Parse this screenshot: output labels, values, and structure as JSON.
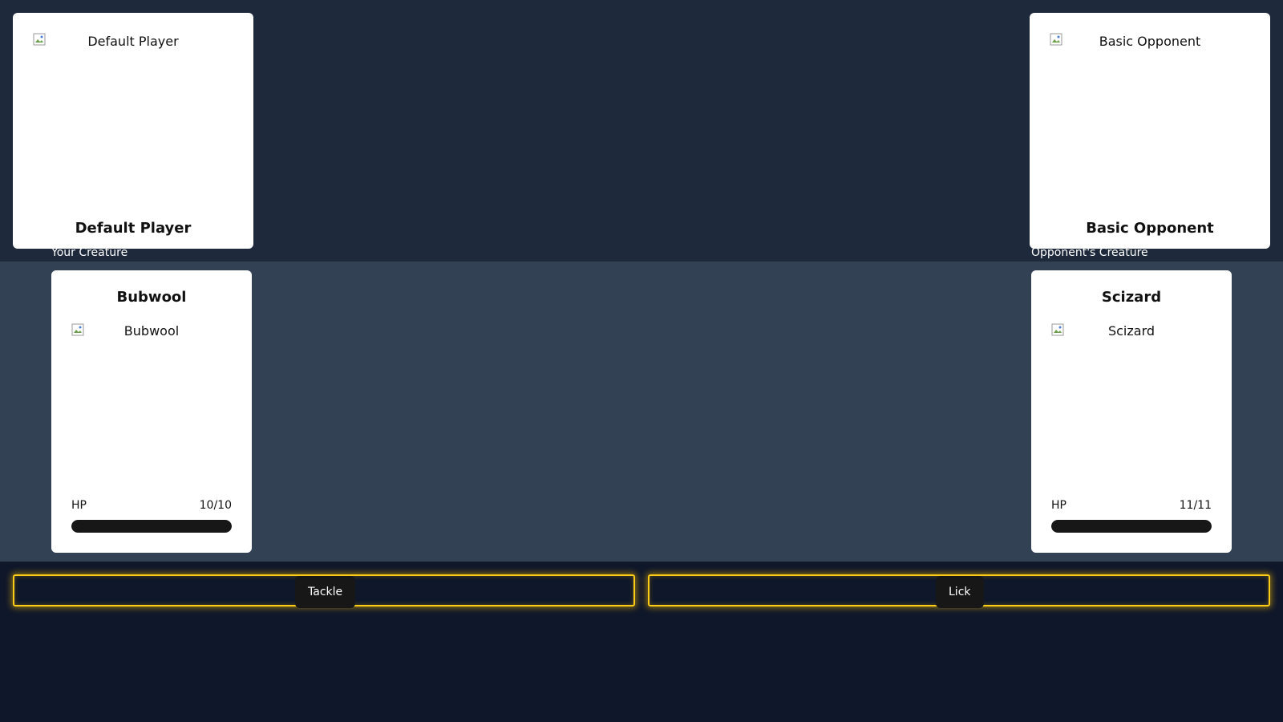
{
  "player": {
    "name": "Default Player",
    "image_alt": "Default Player"
  },
  "opponent": {
    "name": "Basic Opponent",
    "image_alt": "Basic Opponent"
  },
  "your_creature": {
    "section_label": "Your Creature",
    "name": "Bubwool",
    "image_alt": "Bubwool",
    "hp_label": "HP",
    "hp_text": "10/10",
    "hp_fraction": 1.0
  },
  "opponent_creature": {
    "section_label": "Opponent's Creature",
    "name": "Scizard",
    "image_alt": "Scizard",
    "hp_label": "HP",
    "hp_text": "11/11",
    "hp_fraction": 1.0
  },
  "moves": [
    {
      "label": "Tackle"
    },
    {
      "label": "Lick"
    }
  ],
  "colors": {
    "top_bg": "#1e293b",
    "mid_bg": "#334155",
    "bottom_bg": "#0f172a",
    "move_glow": "#facc15",
    "hp_fill": "#171717"
  }
}
